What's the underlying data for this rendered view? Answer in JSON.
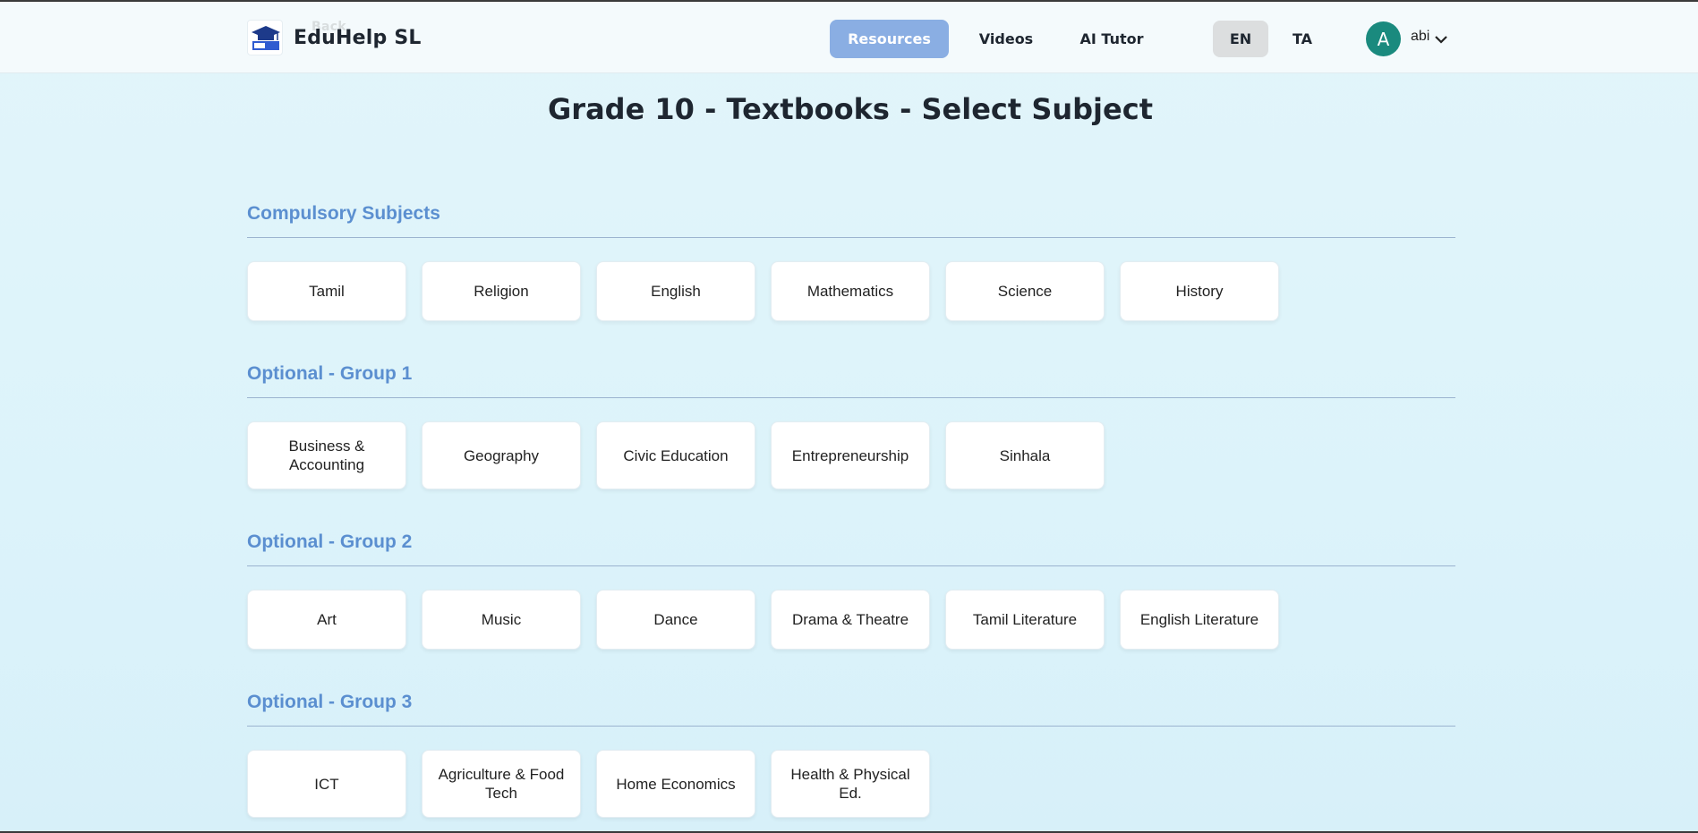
{
  "header": {
    "brand_name": "EduHelp SL",
    "back_label": "Back",
    "nav": [
      {
        "label": "Resources",
        "active": true
      },
      {
        "label": "Videos",
        "active": false
      },
      {
        "label": "AI Tutor",
        "active": false
      }
    ],
    "languages": [
      {
        "label": "EN",
        "active": true
      },
      {
        "label": "TA",
        "active": false
      }
    ],
    "user": {
      "initial": "A",
      "name": "abi"
    }
  },
  "page_title": "Grade 10 - Textbooks - Select Subject",
  "sections": [
    {
      "title": "Compulsory Subjects",
      "subjects": [
        "Tamil",
        "Religion",
        "English",
        "Mathematics",
        "Science",
        "History"
      ]
    },
    {
      "title": "Optional - Group 1",
      "subjects": [
        "Business & Accounting",
        "Geography",
        "Civic Education",
        "Entrepreneurship",
        "Sinhala"
      ]
    },
    {
      "title": "Optional - Group 2",
      "subjects": [
        "Art",
        "Music",
        "Dance",
        "Drama & Theatre",
        "Tamil Literature",
        "English Literature"
      ]
    },
    {
      "title": "Optional - Group 3",
      "subjects": [
        "ICT",
        "Agriculture & Food Tech",
        "Home Economics",
        "Health & Physical Ed."
      ]
    }
  ],
  "colors": {
    "accent": "#8aaee3",
    "section_title": "#5b8fd0",
    "avatar": "#1a8a7e"
  }
}
